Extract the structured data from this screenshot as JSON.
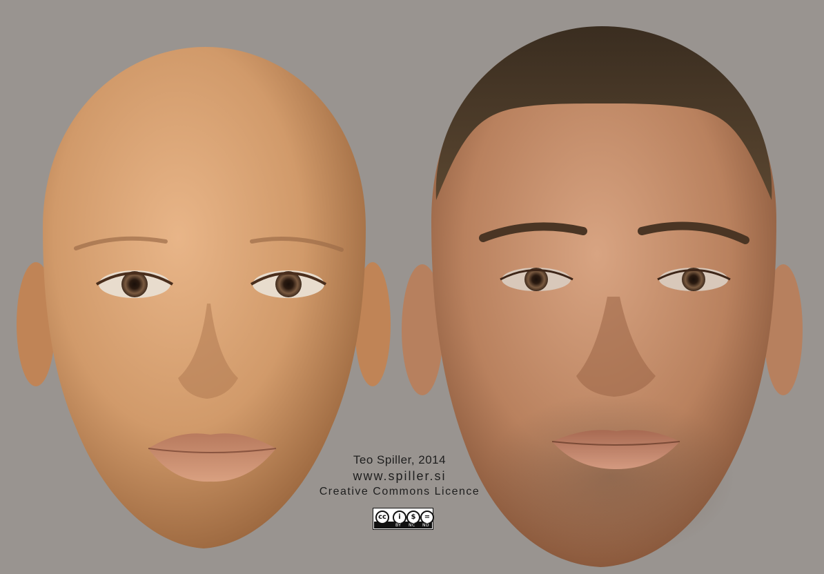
{
  "scene": {
    "background_color": "#999490",
    "subjects": [
      "female-face-bald",
      "male-face-short-hair"
    ]
  },
  "credits": {
    "author_year": "Teo Spiller, 2014",
    "website": "www.spiller.si",
    "licence": "Creative Commons Licence"
  },
  "license_badge": {
    "main_symbol": "cc",
    "attributes": [
      "BY",
      "NC",
      "ND"
    ]
  }
}
